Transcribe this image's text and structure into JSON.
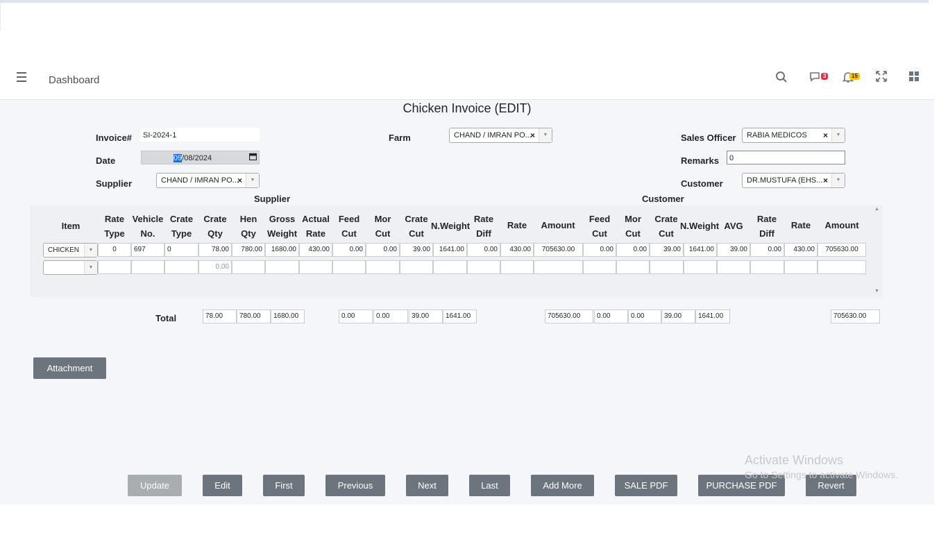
{
  "nav": {
    "dashboard": "Dashboard",
    "messages_badge": "3",
    "notifications_badge": "15"
  },
  "page": {
    "title": "Chicken Invoice (EDIT)"
  },
  "form": {
    "invoice_label": "Invoice#",
    "invoice_value": "SI-2024-1",
    "date_label": "Date",
    "date_day": "09",
    "date_rest": "/08/2024",
    "supplier_label": "Supplier",
    "supplier_value": "CHAND / IMRAN PO...",
    "farm_label": "Farm",
    "farm_value": "CHAND / IMRAN PO...",
    "sales_officer_label": "Sales Officer",
    "sales_officer_value": "RABIA MEDICOS",
    "remarks_label": "Remarks",
    "remarks_value": "0",
    "customer_label": "Customer",
    "customer_value": "DR.MUSTUFA (EHS..."
  },
  "grid": {
    "supplier_section": "Supplier",
    "customer_section": "Customer",
    "headers": {
      "item": "Item",
      "rate_type": "Rate Type",
      "vehicle_no": "Vehicle No.",
      "crate_type": "Crate Type",
      "crate_qty": "Crate Qty",
      "hen_qty": "Hen Qty",
      "gross_weight": "Gross Weight",
      "actual_rate": "Actual Rate",
      "feed_cut": "Feed Cut",
      "mor_cut": "Mor Cut",
      "crate_cut": "Crate Cut",
      "n_weight": "N.Weight",
      "rate_diff": "Rate Diff",
      "rate": "Rate",
      "amount": "Amount",
      "c_feed_cut": "Feed Cut",
      "c_mor_cut": "Mor Cut",
      "c_crate_cut": "Crate Cut",
      "c_n_weight": "N.Weight",
      "avg": "AVG",
      "c_rate_diff": "Rate Diff",
      "c_rate": "Rate",
      "c_amount": "Amount"
    },
    "row1": {
      "item": "CHICKEN",
      "rate_type": "0",
      "vehicle_no": "697",
      "crate_type": "0",
      "crate_qty": "78.00",
      "hen_qty": "780.00",
      "gross_weight": "1680.00",
      "actual_rate": "430.00",
      "feed_cut": "0.00",
      "mor_cut": "0.00",
      "crate_cut": "39.00",
      "n_weight": "1641.00",
      "rate_diff": "0.00",
      "rate": "430.00",
      "amount": "705630.00",
      "c_feed_cut": "0.00",
      "c_mor_cut": "0.00",
      "c_crate_cut": "39.00",
      "c_n_weight": "1641.00",
      "avg": "39.00",
      "c_rate_diff": "0.00",
      "c_rate": "430.00",
      "c_amount": "705630.00"
    },
    "row2": {
      "crate_qty_placeholder": "0.00"
    }
  },
  "totals": {
    "label": "Total",
    "crate_qty": "78.00",
    "hen_qty": "780.00",
    "gross_weight": "1680.00",
    "feed_cut": "0.00",
    "mor_cut": "0.00",
    "crate_cut": "39.00",
    "n_weight": "1641.00",
    "amount": "705630.00",
    "c_feed_cut": "0.00",
    "c_mor_cut": "0.00",
    "c_crate_cut": "39.00",
    "c_n_weight": "1641.00",
    "c_amount": "705630.00"
  },
  "buttons": {
    "attachment": "Attachment",
    "update": "Update",
    "edit": "Edit",
    "first": "First",
    "previous": "Previous",
    "next": "Next",
    "last": "Last",
    "add_more": "Add More",
    "sale_pdf": "SALE PDF",
    "purchase_pdf": "PURCHASE PDF",
    "revert": "Revert"
  },
  "watermark": {
    "line1": "Activate Windows",
    "line2": "Go to Settings to activate Windows."
  },
  "colors": {
    "badge_red": "#dc3545",
    "badge_yellow": "#ffc107",
    "button": "#6c757d",
    "highlight": "#0d6efd"
  }
}
